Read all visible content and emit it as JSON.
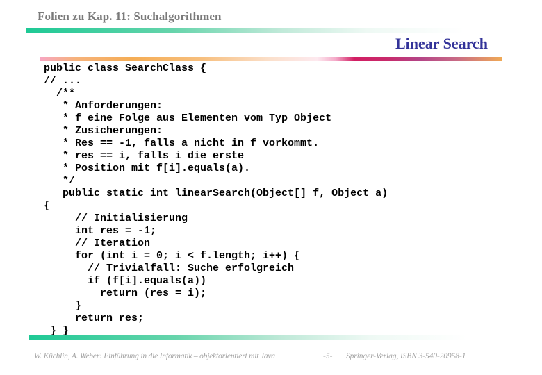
{
  "header": {
    "title": "Folien zu Kap. 11: Suchalgorithmen"
  },
  "slide": {
    "title": "Linear Search"
  },
  "code": {
    "lines": [
      "public class SearchClass {",
      "// ...",
      "  /**",
      "   * Anforderungen:",
      "   * f eine Folge aus Elementen vom Typ Object",
      "   * Zusicherungen:",
      "   * Res == -1, falls a nicht in f vorkommt.",
      "   * res == i, falls i die erste",
      "   * Position mit f[i].equals(a).",
      "   */",
      "   public static int linearSearch(Object[] f, Object a)",
      "{",
      "     // Initialisierung",
      "     int res = -1;",
      "     // Iteration",
      "     for (int i = 0; i < f.length; i++) {",
      "       // Trivialfall: Suche erfolgreich",
      "       if (f[i].equals(a))",
      "         return (res = i);",
      "     }",
      "     return res;",
      " } }"
    ]
  },
  "footer": {
    "citation": "W. Küchlin, A. Weber: Einführung in die Informatik – objektorientiert mit Java",
    "page": "-5-",
    "publisher": "Springer-Verlag, ISBN 3-540-20958-1"
  },
  "colors": {
    "header_text": "#7a7a7a",
    "title_text": "#333399",
    "green_bar": "#1ec995",
    "magenta_accent": "#d21e63",
    "orange_accent": "#f5ad55",
    "footer_text": "#a3a3a3"
  }
}
